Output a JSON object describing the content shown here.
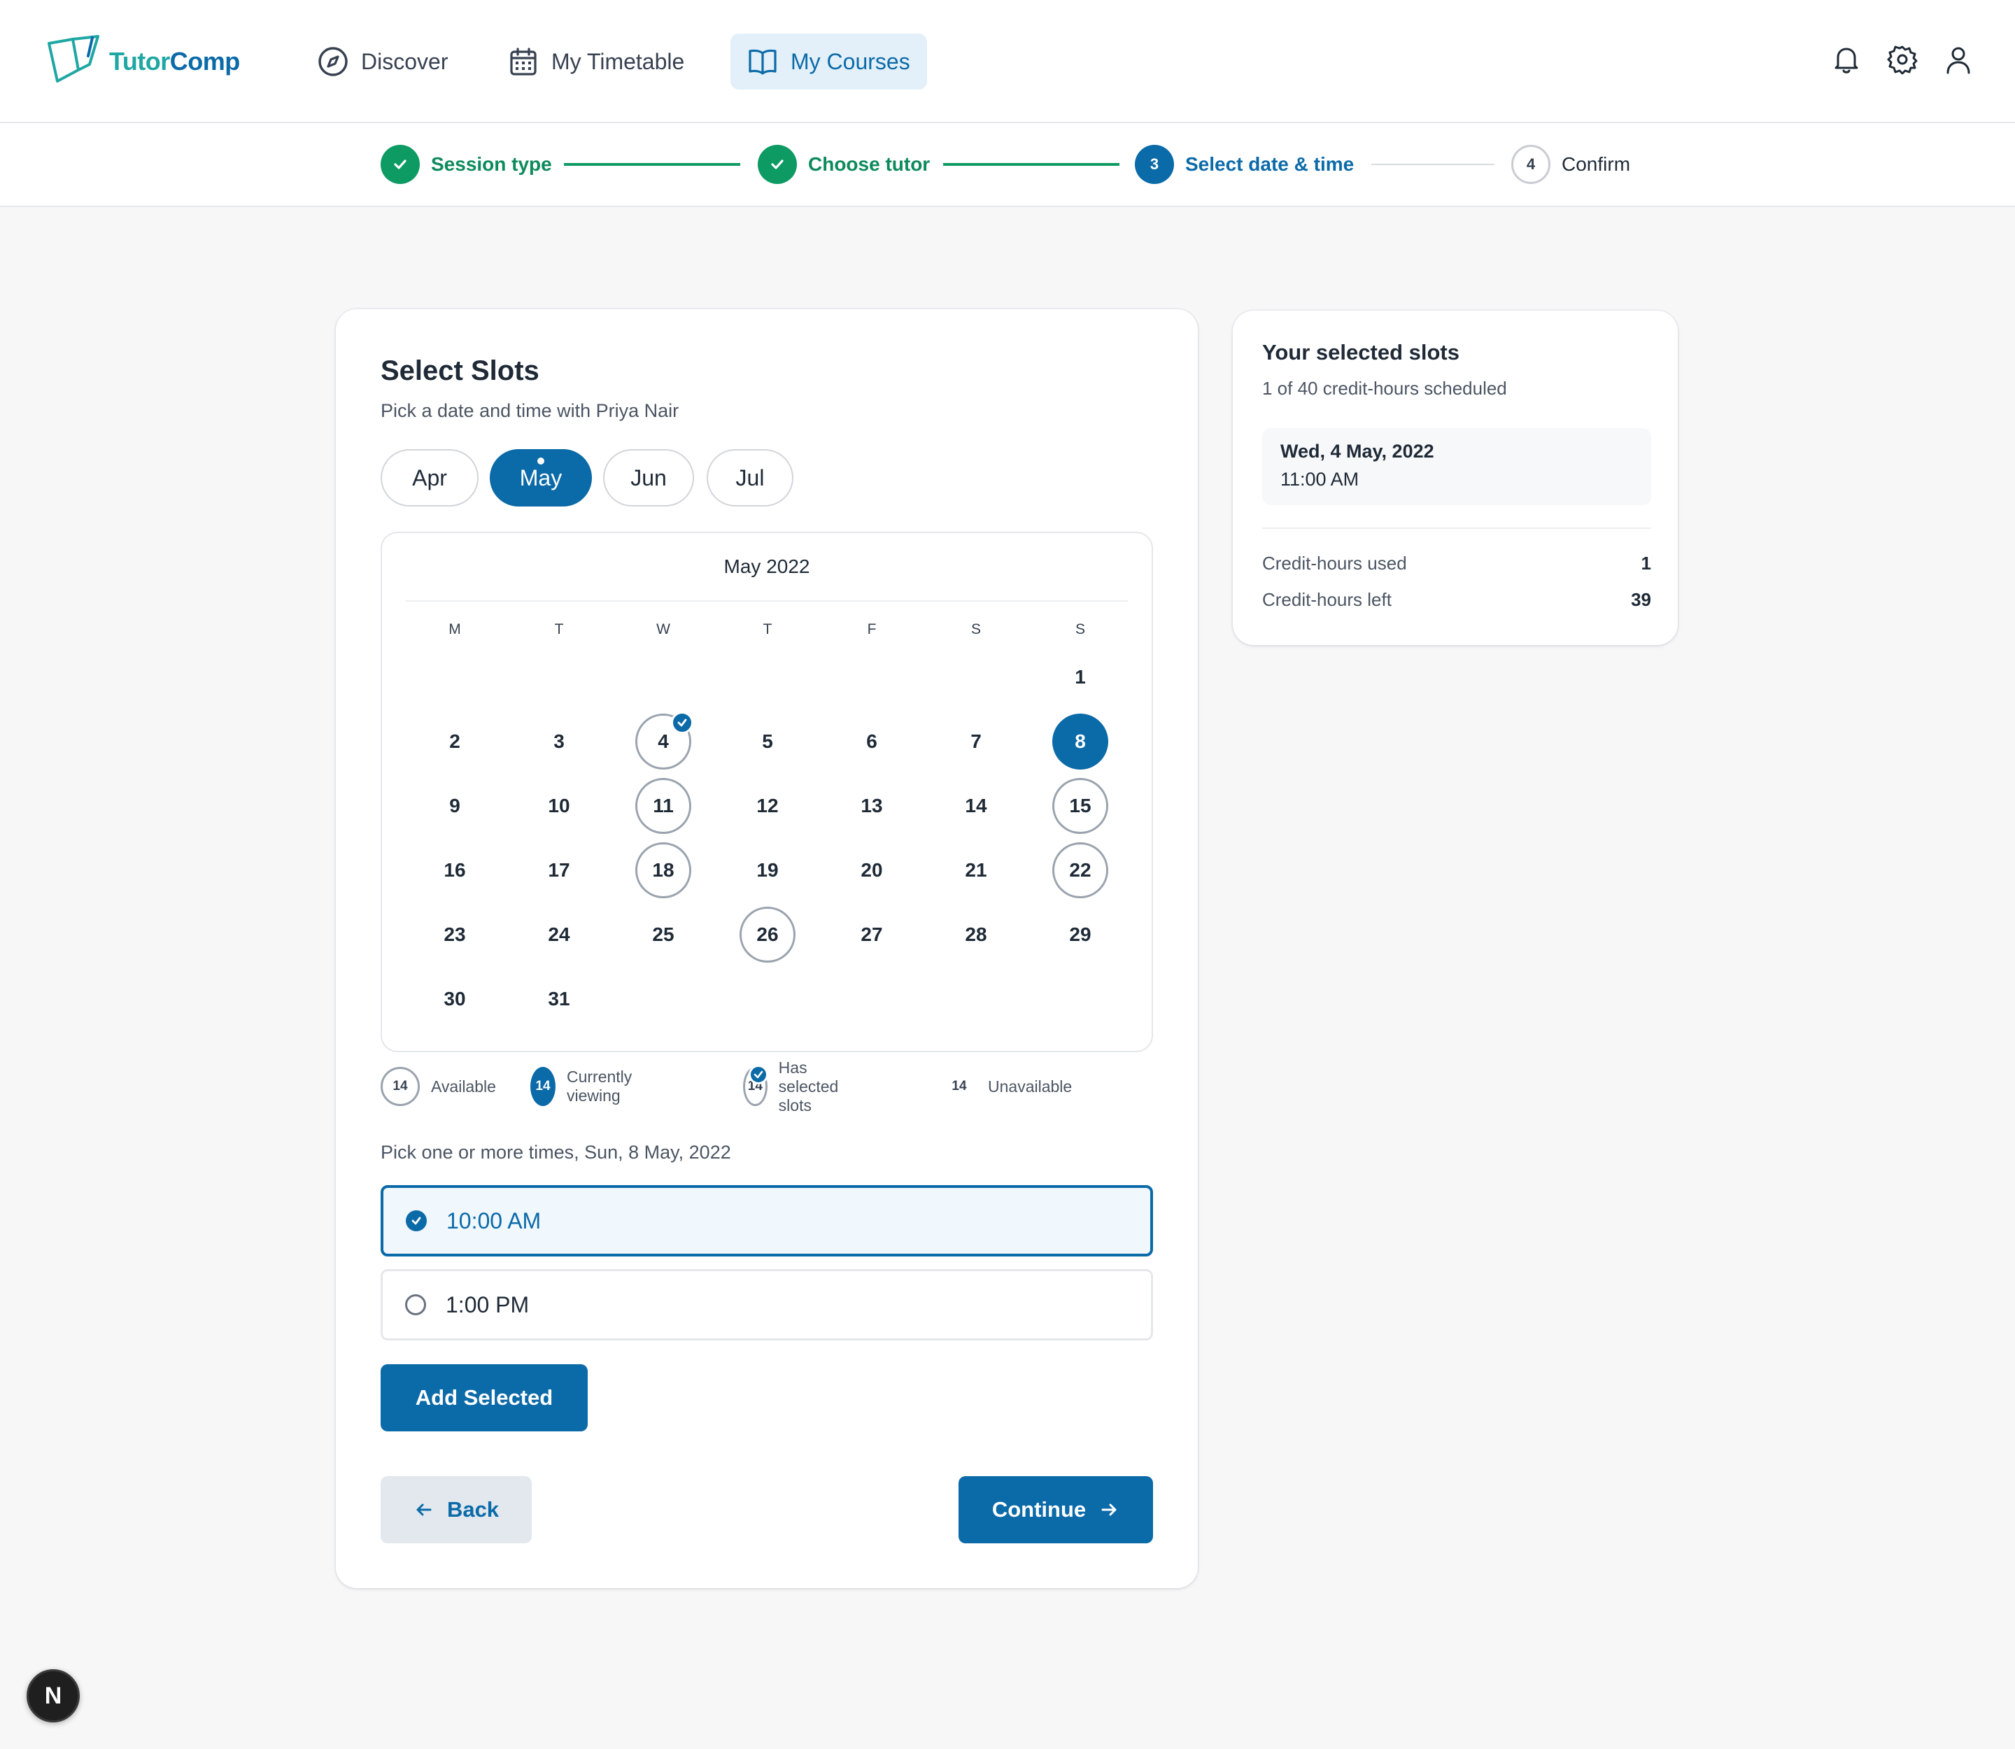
{
  "app": {
    "brand_part1": "Tutor",
    "brand_part2": "Comp"
  },
  "nav": {
    "discover": "Discover",
    "timetable": "My Timetable",
    "courses": "My Courses"
  },
  "stepper": {
    "steps": [
      {
        "label": "Session type",
        "state": "done",
        "num": "1"
      },
      {
        "label": "Choose tutor",
        "state": "done",
        "num": "2"
      },
      {
        "label": "Select date & time",
        "state": "current",
        "num": "3"
      },
      {
        "label": "Confirm",
        "state": "todo",
        "num": "4"
      }
    ]
  },
  "main": {
    "title": "Select Slots",
    "subtitle": "Pick a date and time with Priya Nair",
    "months": [
      "Apr",
      "May",
      "Jun",
      "Jul"
    ],
    "active_month": "May",
    "calendar": {
      "title": "May 2022",
      "weekdays": [
        "M",
        "T",
        "W",
        "T",
        "F",
        "S",
        "S"
      ],
      "days": [
        "1",
        "2",
        "3",
        "4",
        "5",
        "6",
        "7",
        "8",
        "9",
        "10",
        "11",
        "12",
        "13",
        "14",
        "15",
        "16",
        "17",
        "18",
        "19",
        "20",
        "21",
        "22",
        "23",
        "24",
        "25",
        "26",
        "27",
        "28",
        "29",
        "30",
        "31"
      ],
      "available_days": [
        "4",
        "11",
        "15",
        "18",
        "22",
        "26"
      ],
      "current_day": "8",
      "selected_days": [
        "4"
      ]
    },
    "legend": {
      "swatch": "14",
      "available": "Available",
      "current": "Currently viewing",
      "selected": "Has selected slots",
      "unavailable": "Unavailable"
    },
    "pick_label": "Pick one or more times, Sun, 8 May, 2022",
    "times": [
      {
        "label": "10:00 AM",
        "selected": true
      },
      {
        "label": "1:00 PM",
        "selected": false
      }
    ],
    "add_button": "Add Selected",
    "back_button": "Back",
    "continue_button": "Continue"
  },
  "side": {
    "title": "Your selected slots",
    "subtitle": "1 of 40 credit-hours scheduled",
    "slot_date": "Wed, 4 May, 2022",
    "slot_time": "11:00 AM",
    "used_label": "Credit-hours used",
    "used_value": "1",
    "left_label": "Credit-hours left",
    "left_value": "39"
  },
  "badge": "N",
  "colors": {
    "primary": "#0b6aa8",
    "success": "#0d9a63",
    "brand_teal": "#1fa7a3"
  }
}
